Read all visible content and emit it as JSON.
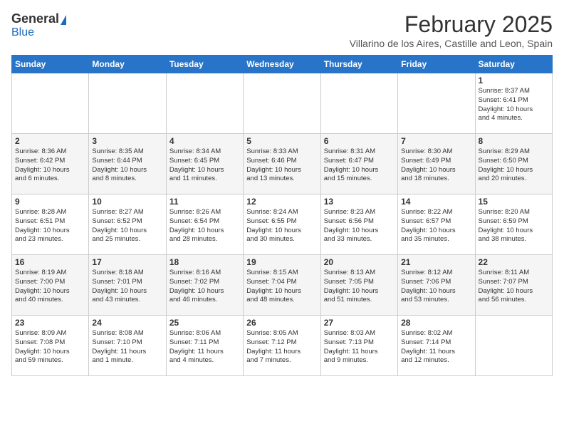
{
  "header": {
    "logo_general": "General",
    "logo_blue": "Blue",
    "month_year": "February 2025",
    "location": "Villarino de los Aires, Castille and Leon, Spain"
  },
  "weekdays": [
    "Sunday",
    "Monday",
    "Tuesday",
    "Wednesday",
    "Thursday",
    "Friday",
    "Saturday"
  ],
  "weeks": [
    [
      {
        "day": "",
        "info": ""
      },
      {
        "day": "",
        "info": ""
      },
      {
        "day": "",
        "info": ""
      },
      {
        "day": "",
        "info": ""
      },
      {
        "day": "",
        "info": ""
      },
      {
        "day": "",
        "info": ""
      },
      {
        "day": "1",
        "info": "Sunrise: 8:37 AM\nSunset: 6:41 PM\nDaylight: 10 hours\nand 4 minutes."
      }
    ],
    [
      {
        "day": "2",
        "info": "Sunrise: 8:36 AM\nSunset: 6:42 PM\nDaylight: 10 hours\nand 6 minutes."
      },
      {
        "day": "3",
        "info": "Sunrise: 8:35 AM\nSunset: 6:44 PM\nDaylight: 10 hours\nand 8 minutes."
      },
      {
        "day": "4",
        "info": "Sunrise: 8:34 AM\nSunset: 6:45 PM\nDaylight: 10 hours\nand 11 minutes."
      },
      {
        "day": "5",
        "info": "Sunrise: 8:33 AM\nSunset: 6:46 PM\nDaylight: 10 hours\nand 13 minutes."
      },
      {
        "day": "6",
        "info": "Sunrise: 8:31 AM\nSunset: 6:47 PM\nDaylight: 10 hours\nand 15 minutes."
      },
      {
        "day": "7",
        "info": "Sunrise: 8:30 AM\nSunset: 6:49 PM\nDaylight: 10 hours\nand 18 minutes."
      },
      {
        "day": "8",
        "info": "Sunrise: 8:29 AM\nSunset: 6:50 PM\nDaylight: 10 hours\nand 20 minutes."
      }
    ],
    [
      {
        "day": "9",
        "info": "Sunrise: 8:28 AM\nSunset: 6:51 PM\nDaylight: 10 hours\nand 23 minutes."
      },
      {
        "day": "10",
        "info": "Sunrise: 8:27 AM\nSunset: 6:52 PM\nDaylight: 10 hours\nand 25 minutes."
      },
      {
        "day": "11",
        "info": "Sunrise: 8:26 AM\nSunset: 6:54 PM\nDaylight: 10 hours\nand 28 minutes."
      },
      {
        "day": "12",
        "info": "Sunrise: 8:24 AM\nSunset: 6:55 PM\nDaylight: 10 hours\nand 30 minutes."
      },
      {
        "day": "13",
        "info": "Sunrise: 8:23 AM\nSunset: 6:56 PM\nDaylight: 10 hours\nand 33 minutes."
      },
      {
        "day": "14",
        "info": "Sunrise: 8:22 AM\nSunset: 6:57 PM\nDaylight: 10 hours\nand 35 minutes."
      },
      {
        "day": "15",
        "info": "Sunrise: 8:20 AM\nSunset: 6:59 PM\nDaylight: 10 hours\nand 38 minutes."
      }
    ],
    [
      {
        "day": "16",
        "info": "Sunrise: 8:19 AM\nSunset: 7:00 PM\nDaylight: 10 hours\nand 40 minutes."
      },
      {
        "day": "17",
        "info": "Sunrise: 8:18 AM\nSunset: 7:01 PM\nDaylight: 10 hours\nand 43 minutes."
      },
      {
        "day": "18",
        "info": "Sunrise: 8:16 AM\nSunset: 7:02 PM\nDaylight: 10 hours\nand 46 minutes."
      },
      {
        "day": "19",
        "info": "Sunrise: 8:15 AM\nSunset: 7:04 PM\nDaylight: 10 hours\nand 48 minutes."
      },
      {
        "day": "20",
        "info": "Sunrise: 8:13 AM\nSunset: 7:05 PM\nDaylight: 10 hours\nand 51 minutes."
      },
      {
        "day": "21",
        "info": "Sunrise: 8:12 AM\nSunset: 7:06 PM\nDaylight: 10 hours\nand 53 minutes."
      },
      {
        "day": "22",
        "info": "Sunrise: 8:11 AM\nSunset: 7:07 PM\nDaylight: 10 hours\nand 56 minutes."
      }
    ],
    [
      {
        "day": "23",
        "info": "Sunrise: 8:09 AM\nSunset: 7:08 PM\nDaylight: 10 hours\nand 59 minutes."
      },
      {
        "day": "24",
        "info": "Sunrise: 8:08 AM\nSunset: 7:10 PM\nDaylight: 11 hours\nand 1 minute."
      },
      {
        "day": "25",
        "info": "Sunrise: 8:06 AM\nSunset: 7:11 PM\nDaylight: 11 hours\nand 4 minutes."
      },
      {
        "day": "26",
        "info": "Sunrise: 8:05 AM\nSunset: 7:12 PM\nDaylight: 11 hours\nand 7 minutes."
      },
      {
        "day": "27",
        "info": "Sunrise: 8:03 AM\nSunset: 7:13 PM\nDaylight: 11 hours\nand 9 minutes."
      },
      {
        "day": "28",
        "info": "Sunrise: 8:02 AM\nSunset: 7:14 PM\nDaylight: 11 hours\nand 12 minutes."
      },
      {
        "day": "",
        "info": ""
      }
    ]
  ]
}
